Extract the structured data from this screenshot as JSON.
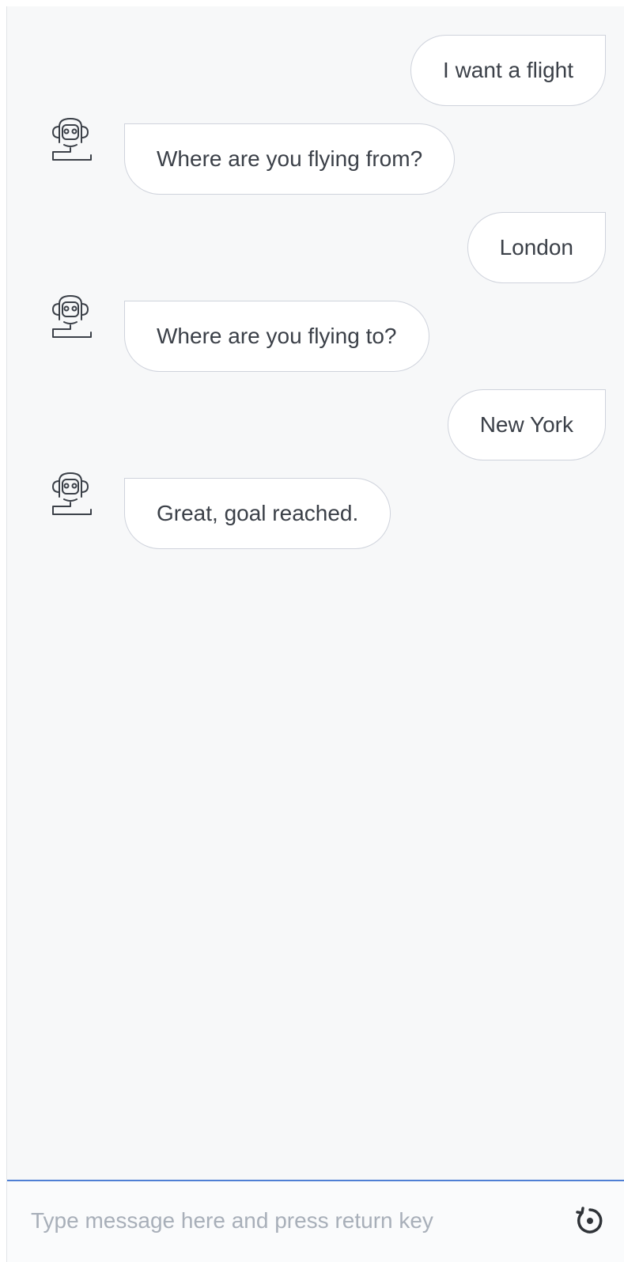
{
  "conversation": {
    "messages": [
      {
        "sender": "user",
        "text": "I want a flight"
      },
      {
        "sender": "bot",
        "avatar_icon": "robot-icon",
        "text": "Where are you flying from?"
      },
      {
        "sender": "user",
        "text": "London"
      },
      {
        "sender": "bot",
        "avatar_icon": "robot-icon",
        "text": "Where are you flying to?"
      },
      {
        "sender": "user",
        "text": "New York"
      },
      {
        "sender": "bot",
        "avatar_icon": "robot-icon",
        "text": "Great, goal reached."
      }
    ]
  },
  "composer": {
    "value": "",
    "placeholder": "Type message here and press return key",
    "action_icon": "restart-icon"
  },
  "colors": {
    "background": "#f7f8f9",
    "bubble_background": "#ffffff",
    "bubble_border": "#cfd3dc",
    "text": "#3b4048",
    "placeholder": "#a8afb9",
    "accent_line": "#4f7fd4"
  }
}
